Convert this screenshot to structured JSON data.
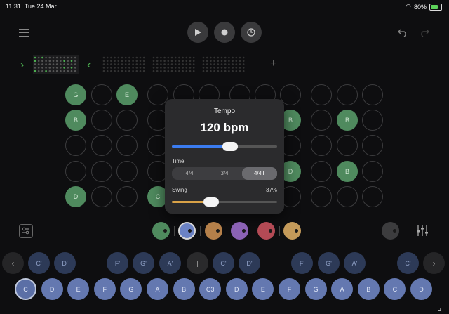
{
  "status": {
    "time": "11:31",
    "date": "Tue 24 Mar",
    "battery": "80%"
  },
  "toolbar": {
    "play_icon": "play-icon",
    "record_icon": "record-icon",
    "clock_icon": "clock-icon",
    "undo_icon": "undo-icon",
    "redo_icon": "redo-icon",
    "menu_icon": "menu-icon"
  },
  "patterns": {
    "prev": "›",
    "next": "‹",
    "add": "+"
  },
  "grid": {
    "rows": [
      [
        "G",
        "",
        "E",
        "",
        "",
        "",
        "",
        "",
        "",
        "",
        "",
        ""
      ],
      [
        "B",
        "",
        "",
        "",
        "",
        "",
        "",
        "",
        "B",
        "",
        "B",
        ""
      ],
      [
        "",
        "",
        "",
        "",
        "",
        "",
        "",
        "",
        "",
        "",
        "",
        ""
      ],
      [
        "",
        "",
        "",
        "",
        "",
        "",
        "",
        "",
        "D",
        "",
        "B",
        ""
      ],
      [
        "D",
        "",
        "",
        "C",
        "",
        "",
        "",
        "",
        "",
        "",
        "",
        ""
      ]
    ],
    "active": [
      [
        true,
        false,
        true,
        false,
        false,
        false,
        false,
        false,
        false,
        false,
        false,
        false
      ],
      [
        true,
        false,
        false,
        false,
        false,
        false,
        false,
        false,
        true,
        false,
        true,
        false
      ],
      [
        false,
        false,
        false,
        false,
        false,
        false,
        false,
        false,
        false,
        false,
        false,
        false
      ],
      [
        false,
        false,
        false,
        false,
        false,
        false,
        false,
        false,
        true,
        false,
        true,
        false
      ],
      [
        true,
        false,
        false,
        true,
        false,
        false,
        false,
        false,
        false,
        false,
        false,
        false
      ]
    ]
  },
  "tempo_modal": {
    "title": "Tempo",
    "bpm_label": "120 bpm",
    "bpm_slider_fraction": 0.55,
    "time_label": "Time",
    "time_options": [
      "4/4",
      "3/4",
      "4/4T"
    ],
    "time_selected": "4/4T",
    "swing_label": "Swing",
    "swing_value": "37%",
    "swing_fraction": 0.37
  },
  "instruments": [
    {
      "color": "#4f8a5e"
    },
    {
      "color": "#6b82c4"
    },
    {
      "color": "#b5804a"
    },
    {
      "color": "#8b62b5"
    },
    {
      "color": "#b34a55"
    },
    {
      "color": "#c49a5a"
    }
  ],
  "keyboard": {
    "upper": [
      "‹",
      "C'",
      "D'",
      "",
      "F'",
      "G'",
      "A'",
      "|",
      "C'",
      "D'",
      "",
      "F'",
      "G'",
      "A'",
      "",
      "C'",
      "›"
    ],
    "lower": [
      "C",
      "D",
      "E",
      "F",
      "G",
      "A",
      "B",
      "C3",
      "D",
      "E",
      "F",
      "G",
      "A",
      "B",
      "C",
      "D"
    ],
    "active_key": "C"
  }
}
